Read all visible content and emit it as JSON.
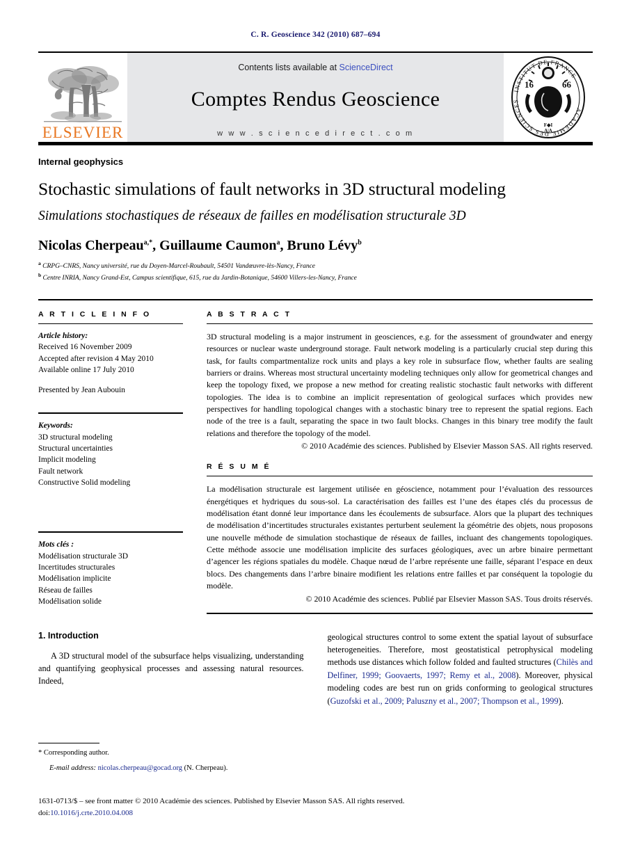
{
  "running_head": "C. R. Geoscience 342 (2010) 687–694",
  "banner": {
    "contents_prefix": "Contents lists available at ",
    "sciencedirect": "ScienceDirect",
    "journal_name": "Comptes Rendus Geoscience",
    "url": "w w w . s c i e n c e d i r e c t . c o m",
    "publisher_logo_text": "ELSEVIER",
    "seal_text_top": "INSTITUT DE FRANCE",
    "seal_text_bottom": "ACADÉMIE DES SCIENCES",
    "seal_year_left": "16",
    "seal_year_right": "66"
  },
  "article": {
    "category": "Internal geophysics",
    "title_en": "Stochastic simulations of fault networks in 3D structural modeling",
    "title_fr": "Simulations stochastiques de réseaux de failles en modélisation structurale 3D",
    "authors": [
      {
        "name": "Nicolas Cherpeau",
        "marks": "a,*"
      },
      {
        "name": "Guillaume Caumon",
        "marks": "a"
      },
      {
        "name": "Bruno Lévy",
        "marks": "b"
      }
    ],
    "affiliations": [
      {
        "mark": "a",
        "text": "CRPG–CNRS, Nancy université, rue du Doyen-Marcel-Roubault, 54501 Vandœuvre-lès-Nancy, France"
      },
      {
        "mark": "b",
        "text": "Centre INRIA, Nancy Grand-Est, Campus scientifique, 615, rue du Jardin-Botanique, 54600 Villers-les-Nancy, France"
      }
    ]
  },
  "article_info": {
    "heading": "A R T I C L E   I N F O",
    "history_label": "Article history:",
    "history": [
      "Received 16 November 2009",
      "Accepted after revision 4 May 2010",
      "Available online 17 July 2010"
    ],
    "presented_by": "Presented by Jean Aubouin",
    "keywords_label": "Keywords:",
    "keywords": [
      "3D structural modeling",
      "Structural uncertainties",
      "Implicit modeling",
      "Fault network",
      "Constructive Solid modeling"
    ],
    "motscles_label": "Mots clés :",
    "motscles": [
      "Modélisation structurale 3D",
      "Incertitudes structurales",
      "Modélisation implicite",
      "Réseau de failles",
      "Modélisation solide"
    ]
  },
  "abstract": {
    "heading": "A B S T R A C T",
    "text": "3D structural modeling is a major instrument in geosciences, e.g. for the assessment of groundwater and energy resources or nuclear waste underground storage. Fault network modeling is a particularly crucial step during this task, for faults compartmentalize rock units and plays a key role in subsurface flow, whether faults are sealing barriers or drains. Whereas most structural uncertainty modeling techniques only allow for geometrical changes and keep the topology fixed, we propose a new method for creating realistic stochastic fault networks with different topologies. The idea is to combine an implicit representation of geological surfaces which provides new perspectives for handling topological changes with a stochastic binary tree to represent the spatial regions. Each node of the tree is a fault, separating the space in two fault blocks. Changes in this binary tree modify the fault relations and therefore the topology of the model.",
    "copyright": "© 2010 Académie des sciences. Published by Elsevier Masson SAS. All rights reserved."
  },
  "resume": {
    "heading": "R É S U M É",
    "text": "La modélisation structurale est largement utilisée en géoscience, notamment pour l’évaluation des ressources énergétiques et hydriques du sous-sol. La caractérisation des failles est l’une des étapes clés du processus de modélisation étant donné leur importance dans les écoulements de subsurface. Alors que la plupart des techniques de modélisation d’incertitudes structurales existantes perturbent seulement la géométrie des objets, nous proposons une nouvelle méthode de simulation stochastique de réseaux de failles, incluant des changements topologiques. Cette méthode associe une modélisation implicite des surfaces géologiques, avec un arbre binaire permettant d’agencer les régions spatiales du modèle. Chaque nœud de l’arbre représente une faille, séparant l’espace en deux blocs. Des changements dans l’arbre binaire modifient les relations entre failles et par conséquent la topologie du modèle.",
    "copyright": "© 2010 Académie des sciences. Publié par Elsevier Masson SAS. Tous droits réservés."
  },
  "body": {
    "section_number_title": "1. Introduction",
    "left_paragraph": "A 3D structural model of the subsurface helps visualizing, understanding and quantifying geophysical processes and assessing natural resources. Indeed,",
    "right_paragraph_part1": "geological structures control to some extent the spatial layout of subsurface heterogeneities. Therefore, most geostatistical petrophysical modeling methods use distances which follow folded and faulted structures (",
    "right_citation1": "Chilès and Delfiner, 1999; Goovaerts, 1997; Remy et al., 2008",
    "right_paragraph_part2": "). Moreover, physical modeling codes are best run on grids conforming to geological structures (",
    "right_citation2": "Guzofski et al., 2009; Paluszny et al., 2007; Thompson et al., 1999",
    "right_paragraph_part3": ")."
  },
  "footnote": {
    "marker": "*",
    "corresponding": "Corresponding author.",
    "email_label": "E-mail address:",
    "email": "nicolas.cherpeau@gocad.org",
    "email_suffix": "(N. Cherpeau)."
  },
  "bottom": {
    "issn_line": "1631-0713/$ – see front matter © 2010 Académie des sciences. Published by Elsevier Masson SAS. All rights reserved.",
    "doi_label": "doi:",
    "doi": "10.1016/j.crte.2010.04.008"
  },
  "colors": {
    "link_blue": "#1a2a8e",
    "sciencedirect_blue": "#3b4fbf",
    "elsevier_orange": "#E87722",
    "banner_gray": "#e6e7e9"
  }
}
